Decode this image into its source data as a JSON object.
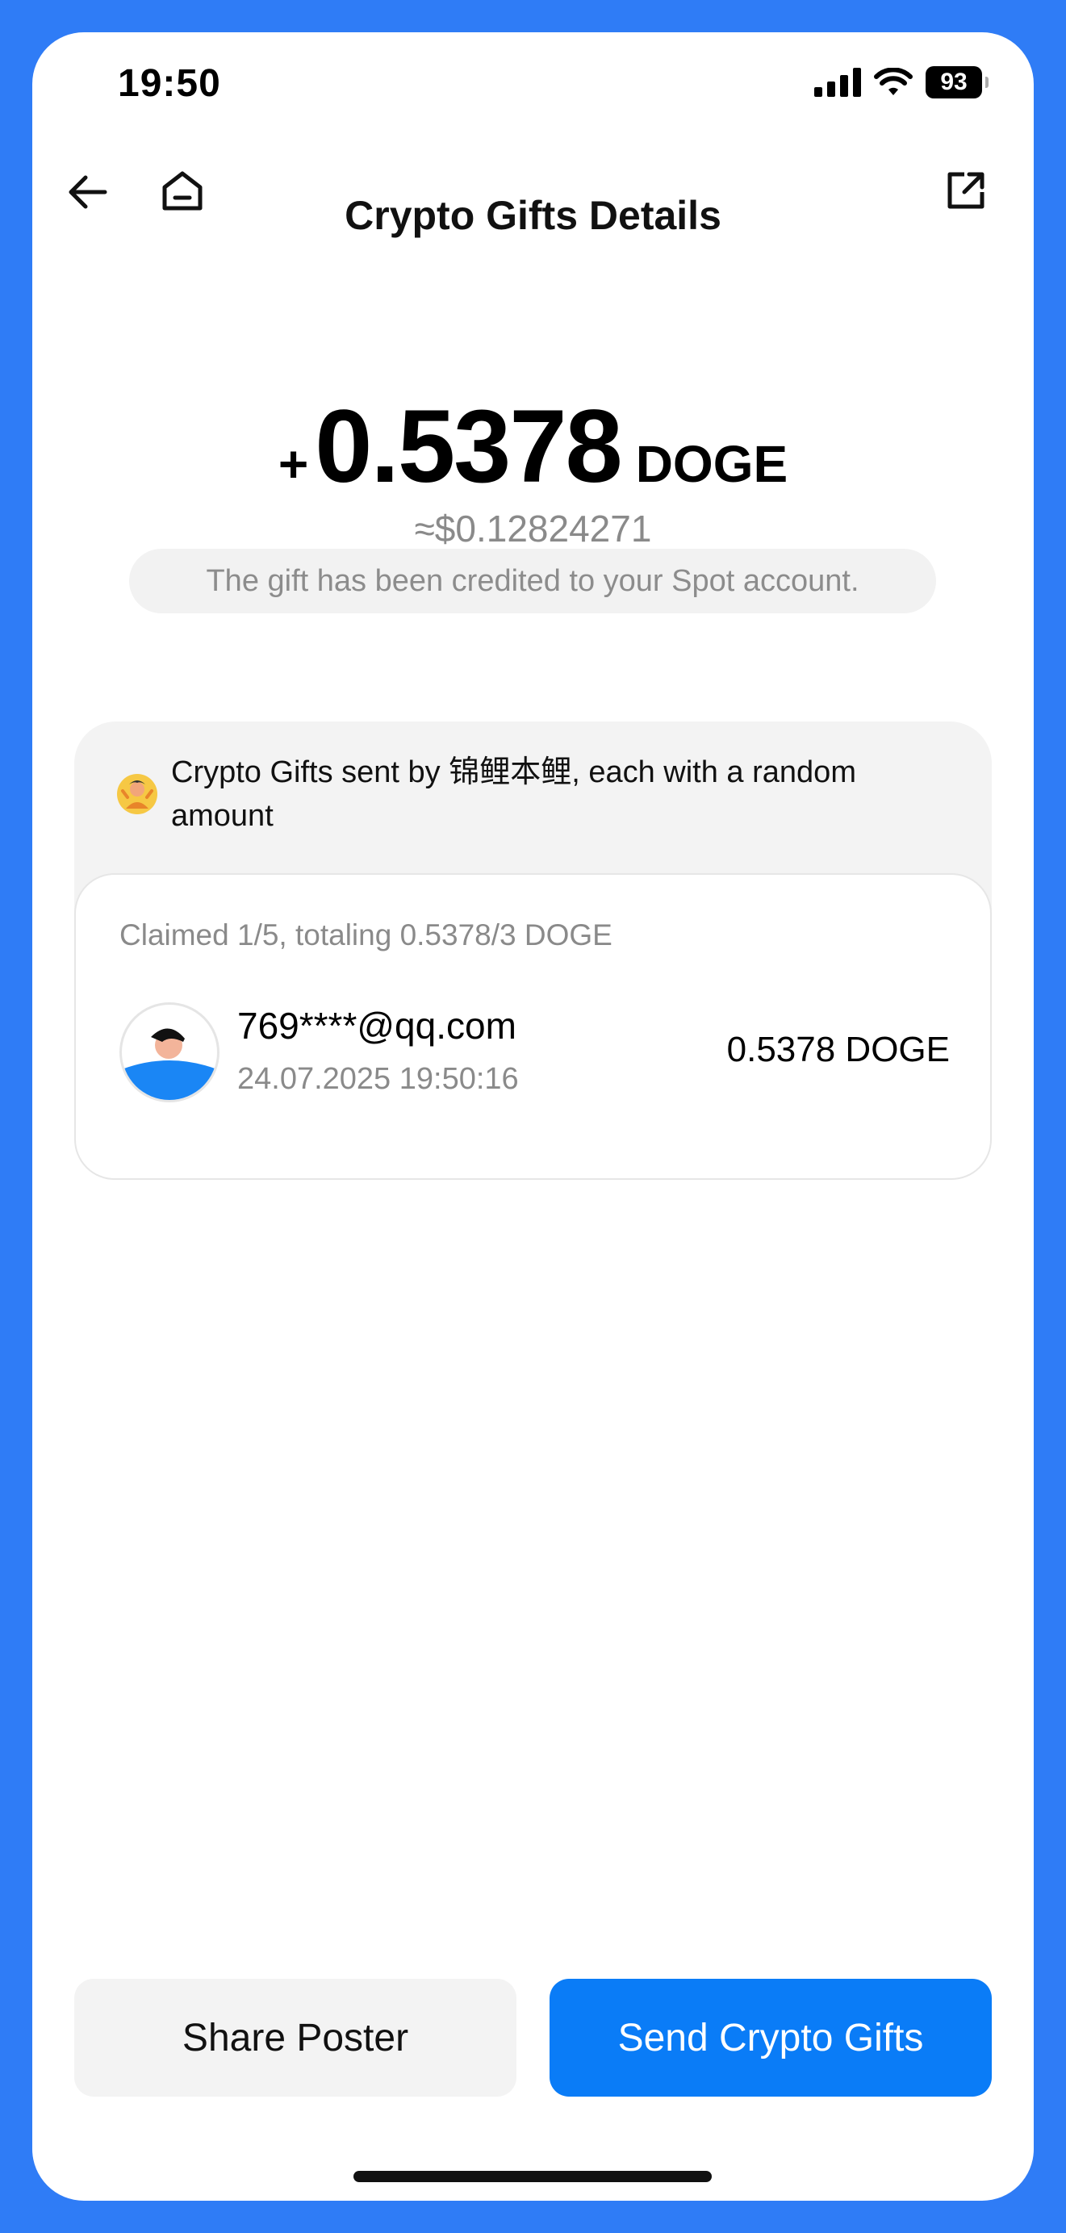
{
  "status_bar": {
    "time": "19:50",
    "battery": "93"
  },
  "nav": {
    "title": "Crypto Gifts Details"
  },
  "gift": {
    "sign": "+",
    "amount": "0.5378",
    "currency": "DOGE",
    "usd_value": "≈$0.12824271",
    "credited_note": "The gift has been credited to your Spot account."
  },
  "gifts_card": {
    "sender_text": "Crypto Gifts sent by 锦鲤本鲤, each with a random amount",
    "claimed_summary": "Claimed 1/5, totaling 0.5378/3 DOGE",
    "claims": [
      {
        "email": "769****@qq.com",
        "datetime": "24.07.2025 19:50:16",
        "amount": "0.5378 DOGE"
      }
    ]
  },
  "actions": {
    "share_label": "Share Poster",
    "send_label": "Send Crypto Gifts"
  },
  "colors": {
    "frame": "#2f7cf6",
    "primary_button": "#0a7cf7",
    "muted_text": "#8a8a8a"
  }
}
